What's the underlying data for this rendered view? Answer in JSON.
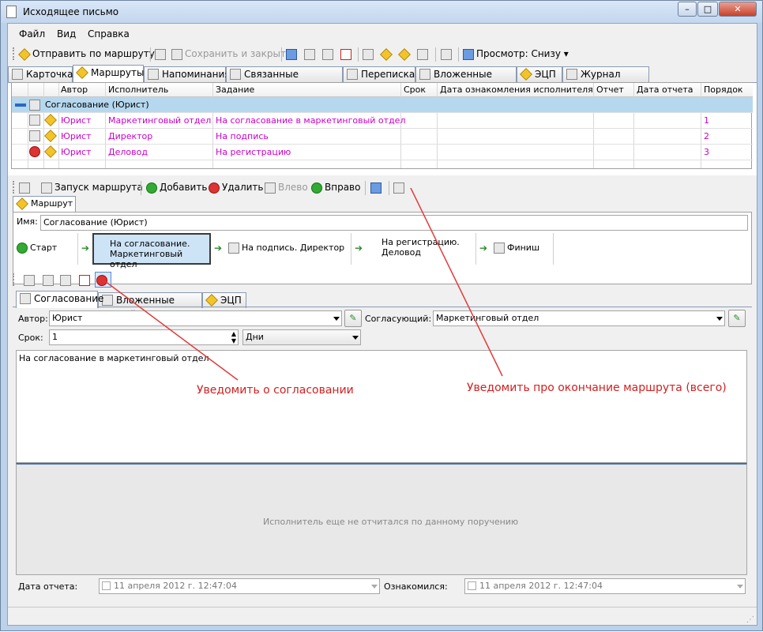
{
  "window": {
    "title": "Исходящее письмо"
  },
  "menu": [
    "Файл",
    "Вид",
    "Справка"
  ],
  "toolbar": {
    "send": "Отправить по маршруту",
    "save_close": "Сохранить и закрыть",
    "preview": "Просмотр: Снизу"
  },
  "tabs": [
    "Карточка",
    "Маршруты",
    "Напоминания",
    "Связанные документы",
    "Переписка",
    "Вложенные файлы",
    "ЭЦП",
    "Журнал версий"
  ],
  "grid": {
    "columns": [
      "Автор",
      "Исполнитель",
      "Задание",
      "Срок",
      "Дата ознакомления исполнителя",
      "Отчет",
      "Дата отчета",
      "Порядок"
    ],
    "group": "Согласование (Юрист)",
    "rows": [
      {
        "author": "Юрист",
        "executor": "Маркетинговый отдел",
        "task": "На согласование в маркетинговый отдел",
        "order": "1"
      },
      {
        "author": "Юрист",
        "executor": "Директор",
        "task": "На подпись",
        "order": "2"
      },
      {
        "author": "Юрист",
        "executor": "Деловод",
        "task": "На регистрацию",
        "order": "3"
      }
    ]
  },
  "route_toolbar": {
    "start": "Запуск маршрута",
    "add": "Добавить",
    "delete": "Удалить",
    "left": "Влево",
    "right": "Вправо"
  },
  "route_tab": "Маршрут",
  "route": {
    "name_label": "Имя:",
    "name_value": "Согласование (Юрист)",
    "steps": [
      "Старт",
      "На согласование.\nМаркетинговый отдел",
      "На подпись. Директор",
      "На регистрацию.\nДеловод",
      "Финиш"
    ]
  },
  "detail_tabs": [
    "Согласование",
    "Вложенные файлы",
    "ЭЦП"
  ],
  "form": {
    "author_label": "Автор:",
    "author_value": "Юрист",
    "approver_label": "Согласующий:",
    "approver_value": "Маркетинговый отдел",
    "term_label": "Срок:",
    "term_value": "1",
    "term_unit": "Дни",
    "task_text": "На согласование в маркетинговый отдел",
    "report_placeholder": "Исполнитель еще не отчитался по данному поручению",
    "report_date_label": "Дата отчета:",
    "report_date_value": "11   апреля   2012 г. 12:47:04",
    "acquainted_label": "Ознакомился:",
    "acquainted_value": "11   апреля   2012 г. 12:47:04"
  },
  "annotations": {
    "notify_approval": "Уведомить о согласовании",
    "notify_route_end": "Уведомить про окончание маршрута (всего)"
  }
}
